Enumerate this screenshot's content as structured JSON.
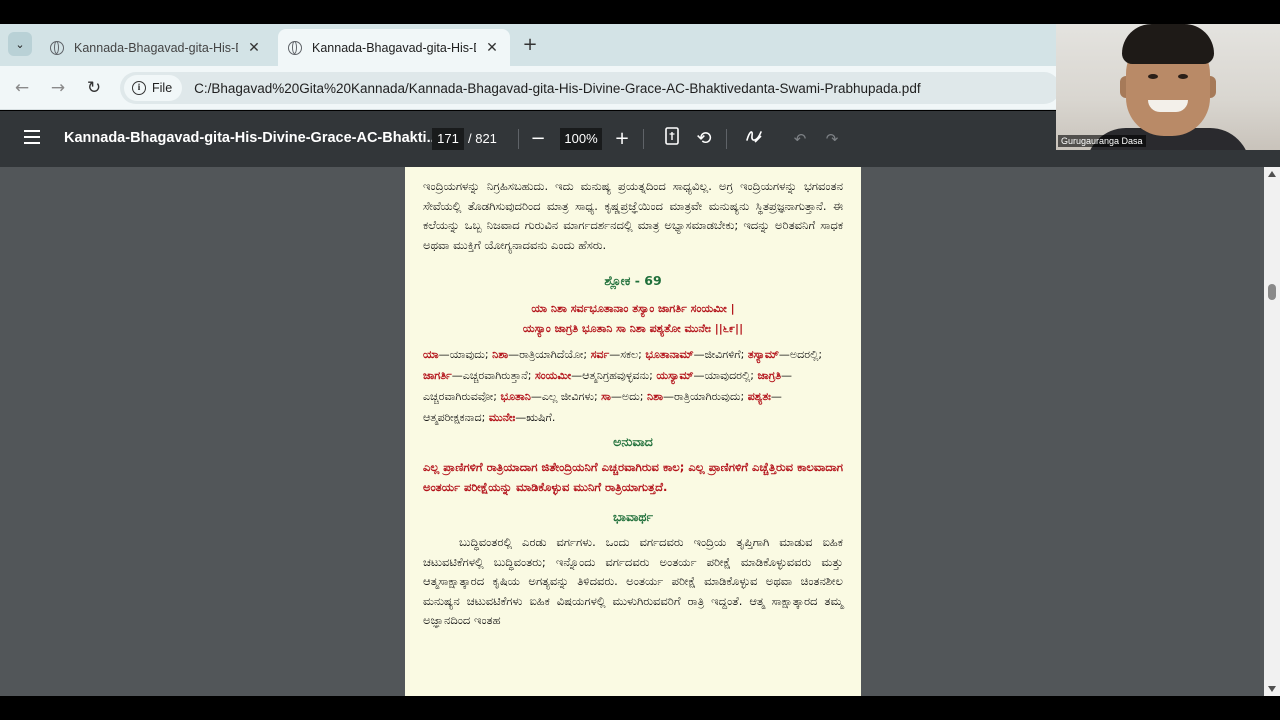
{
  "browser": {
    "tabs": [
      {
        "title": "Kannada-Bhagavad-gita-His-Divine-Grace",
        "active": false
      },
      {
        "title": "Kannada-Bhagavad-gita-His-Divine-Grace",
        "active": true
      }
    ],
    "new_tab": "+",
    "chip_label": "File",
    "url": "C:/Bhagavad%20Gita%20Kannada/Kannada-Bhagavad-gita-His-Divine-Grace-AC-Bhaktivedanta-Swami-Prabhupada.pdf"
  },
  "pdf_toolbar": {
    "title": "Kannada-Bhagavad-gita-His-Divine-Grace-AC-Bhakti...",
    "page_current": "171",
    "page_total": "/ 821",
    "zoom": "100%",
    "zoom_out": "−",
    "zoom_in": "+"
  },
  "webcam": {
    "name": "Gurugauranga Dasa"
  },
  "pdf_page": {
    "intro_paragraph": "ಇಂದ್ರಿಯಗಳನ್ನು ನಿಗ್ರಹಿಸಬಹುದು. ಇದು ಮನುಷ್ಯ ಪ್ರಯತ್ನದಿಂದ ಸಾಧ್ಯವಿಲ್ಲ. ಅಗ್ರ ಇಂದ್ರಿಯಗಳನ್ನು ಭಗವಂತನ ಸೇವೆಯಲ್ಲಿ ತೊಡಗಿಸುವುದರಿಂದ ಮಾತ್ರ ಸಾಧ್ಯ. ಕೃಷ್ಣಪ್ರಜ್ಞೆಯಿಂದ ಮಾತ್ರವೇ ಮನುಷ್ಯನು ಸ್ಥಿತಪ್ರಜ್ಞನಾಗುತ್ತಾನೆ. ಈ ಕಲೆಯನ್ನು ಒಬ್ಬ ನಿಜವಾದ ಗುರುವಿನ ಮಾರ್ಗದರ್ಶನದಲ್ಲಿ ಮಾತ್ರ ಅಭ್ಯಾಸಮಾಡಬೇಕು; ಇದನ್ನು ಅರಿತವನಿಗೆ ಸಾಧಕ ಅಥವಾ ಮುಕ್ತಿಗೆ ಯೋಗ್ಯನಾದವನು ಎಂದು ಹೆಸರು.",
    "shloka_heading": "ಶ್ಲೋಕ - 69",
    "verse_line_1": "ಯಾ ನಿಶಾ ಸರ್ವಭೂತಾನಾಂ ತಸ್ಯಾಂ ಜಾಗರ್ತಿ ಸಂಯಮೀ |",
    "verse_line_2": "ಯಸ್ಯಾಂ ಜಾಗ್ರತಿ ಭೂತಾನಿ ಸಾ ನಿಶಾ ಪಶ್ಯತೋ ಮುನೇಃ ||೬೯||",
    "word_meanings": [
      {
        "term": "ಯಾ",
        "meaning": "—ಯಾವುದು; "
      },
      {
        "term": "ನಿಶಾ",
        "meaning": "—ರಾತ್ರಿಯಾಗಿದೆಯೋ; "
      },
      {
        "term": "ಸರ್ವ",
        "meaning": "—ಸಕಲ; "
      },
      {
        "term": "ಭೂತಾನಾಮ್",
        "meaning": "—ಜೀವಿಗಳಿಗೆ; "
      },
      {
        "term": "ತಸ್ಯಾಮ್",
        "meaning": "—ಅದರಲ್ಲಿ; "
      },
      {
        "term": "ಜಾಗರ್ತಿ",
        "meaning": "—ಎಚ್ಚರವಾಗಿರುತ್ತಾನೆ; "
      },
      {
        "term": "ಸಂಯಮೀ",
        "meaning": "—ಆತ್ಮನಿಗ್ರಹವುಳ್ಳವನು; "
      },
      {
        "term": "ಯಸ್ಯಾಮ್",
        "meaning": "—ಯಾವುದರಲ್ಲಿ; "
      },
      {
        "term": "ಜಾಗ್ರತಿ",
        "meaning": "—ಎಚ್ಚರವಾಗಿರುವವೋ; "
      },
      {
        "term": "ಭೂತಾನಿ",
        "meaning": "—ಎಲ್ಲ ಜೀವಿಗಳು; "
      },
      {
        "term": "ಸಾ",
        "meaning": "—ಅದು; "
      },
      {
        "term": "ನಿಶಾ",
        "meaning": "—ರಾತ್ರಿಯಾಗಿರುವುದು; "
      },
      {
        "term": "ಪಶ್ಯತಃ",
        "meaning": "— ಆತ್ಮಪರೀಕ್ಷಕನಾದ; "
      },
      {
        "term": "ಮುನೇಃ",
        "meaning": "—ಋಷಿಗೆ."
      }
    ],
    "anuvada_heading": "ಅನುವಾದ",
    "translation": "ಎಲ್ಲ ಪ್ರಾಣಿಗಳಿಗೆ ರಾತ್ರಿಯಾದಾಗ ಜಿತೇಂದ್ರಿಯನಿಗೆ ಎಚ್ಚರವಾಗಿರುವ ಕಾಲ; ಎಲ್ಲ ಪ್ರಾಣಿಗಳಿಗೆ ಎಚ್ಚೆತ್ತಿರುವ ಕಾಲವಾದಾಗ ಅಂತರ್ಯ ಪರೀಕ್ಷೆಯನ್ನು ಮಾಡಿಕೊಳ್ಳುವ ಮುನಿಗೆ ರಾತ್ರಿಯಾಗುತ್ತದೆ.",
    "bhavartha_heading": "ಭಾವಾರ್ಥ",
    "purport": "ಬುದ್ಧಿವಂತರಲ್ಲಿ ಎರಡು ವರ್ಗಗಳು. ಒಂದು ವರ್ಗದವರು ಇಂದ್ರಿಯ ತೃಪ್ತಿಗಾಗಿ ಮಾಡುವ ಐಹಿಕ ಚಟುವಟಿಕೆಗಳಲ್ಲಿ ಬುದ್ಧಿವಂತರು; ಇನ್ನೊಂದು ವರ್ಗದವರು ಅಂತರ್ಯ ಪರೀಕ್ಷೆ ಮಾಡಿಕೊಳ್ಳುವವರು ಮತ್ತು ಆತ್ಮಸಾಕ್ಷಾತ್ಕಾರದ ಕೃಷಿಯ ಅಗತ್ಯವನ್ನು ತಿಳಿದವರು. ಅಂತರ್ಯ ಪರೀಕ್ಷೆ ಮಾಡಿಕೊಳ್ಳುವ ಅಥವಾ ಚಿಂತನಶೀಲ ಮನುಷ್ಯನ ಚಟುವಟಿಕೆಗಳು ಐಹಿಕ ವಿಷಯಗಳಲ್ಲಿ ಮುಳುಗಿರುವವರಿಗೆ ರಾತ್ರಿ ಇದ್ದಂತೆ. ಆತ್ಮ ಸಾಕ್ಷಾತ್ಕಾರದ ತಮ್ಮ ಅಜ್ಞಾನದಿಂದ ಇಂತಹ"
  }
}
